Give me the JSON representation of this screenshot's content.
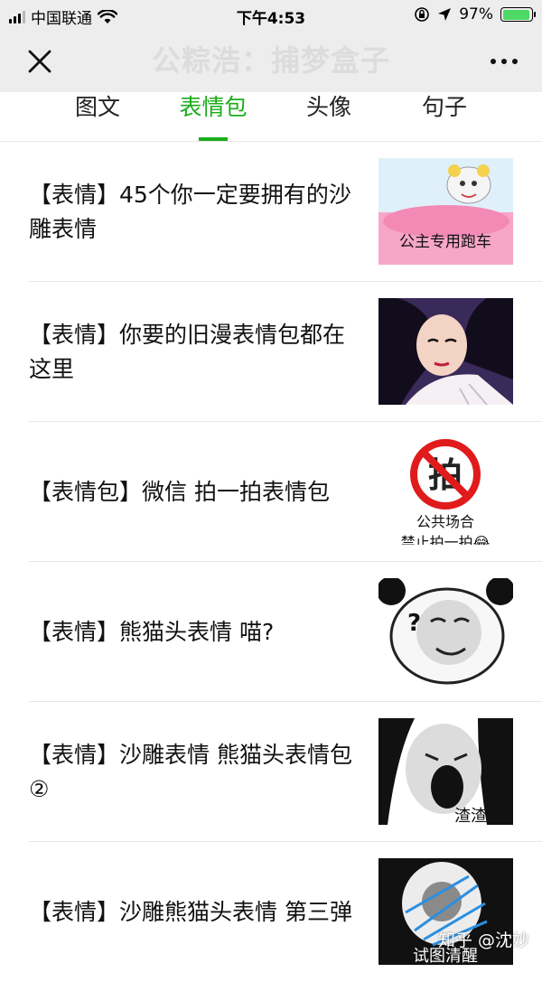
{
  "status_bar": {
    "carrier": "中国联通",
    "time": "下午4:53",
    "battery": "97%",
    "battery_level": 0.97
  },
  "nav": {
    "title": "公粽浩：捕梦盒子",
    "close_icon": "close-icon",
    "more_icon": "more-icon"
  },
  "tabs": [
    {
      "label": "图文",
      "active": false
    },
    {
      "label": "表情包",
      "active": true
    },
    {
      "label": "头像",
      "active": false
    },
    {
      "label": "句子",
      "active": false
    }
  ],
  "articles": [
    {
      "title": "【表情】45个你一定要拥有的沙雕表情",
      "thumb_caption": "公主专用跑车"
    },
    {
      "title": "【表情】你要的旧漫表情包都在这里"
    },
    {
      "title": "【表情包】微信 拍一拍表情包",
      "thumb_caption_1": "拍",
      "thumb_caption_2": "公共场合",
      "thumb_caption_3": "禁止拍一拍😂"
    },
    {
      "title": "【表情】熊猫头表情 喵?",
      "thumb_caption": "?"
    },
    {
      "title": "【表情】沙雕表情 熊猫头表情包②",
      "thumb_caption": "渣渣"
    },
    {
      "title": "【表情】沙雕熊猫头表情 第三弹",
      "thumb_caption": "试图清醒"
    }
  ],
  "watermark": "知乎 @沈妙",
  "colors": {
    "accent": "#1aad19",
    "header_bg": "#ededed"
  }
}
